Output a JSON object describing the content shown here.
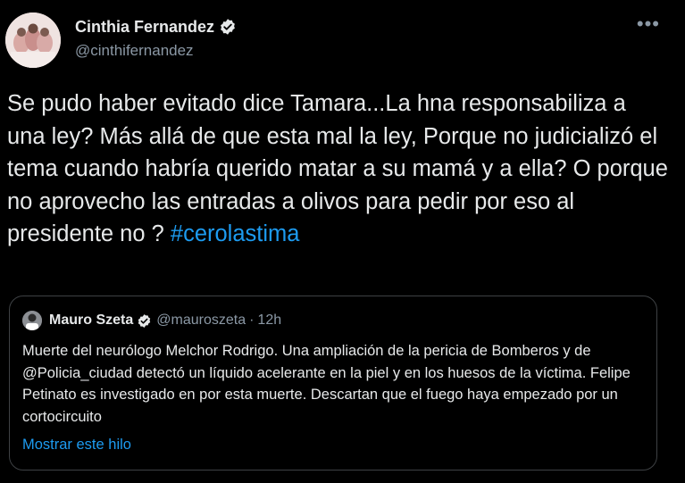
{
  "author": {
    "display_name": "Cinthia Fernandez",
    "handle": "@cinthifernandez",
    "verified_icon": "verified-badge-icon",
    "avatar": "profile photo"
  },
  "more_icon": "more-options-icon",
  "tweet": {
    "text": "Se pudo haber evitado dice Tamara...La hna responsabiliza a una ley? Más allá de que esta mal la ley, Porque no judicializó el tema cuando habría querido matar a su mamá y a ella? O porque no aprovecho las entradas a olivos para pedir por eso al presidente no ? ",
    "hashtag": "#cerolastima"
  },
  "quoted_tweet": {
    "display_name": "Mauro Szeta",
    "handle": "@mauroszeta",
    "separator": "·",
    "time": "12h",
    "text": "Muerte del neurólogo Melchor Rodrigo. Una ampliación de la pericia de Bomberos y de @Policia_ciudad detectó un líquido acelerante en la piel y en los huesos de la víctima. Felipe Petinato es investigado en por esta muerte. Descartan que el fuego haya empezado por un cortocircuito",
    "show_thread": "Mostrar este hilo"
  },
  "colors": {
    "background": "#000000",
    "text": "#e7e9ea",
    "secondary": "#8b98a5",
    "link": "#1d9bf0",
    "border": "#3e4144"
  }
}
